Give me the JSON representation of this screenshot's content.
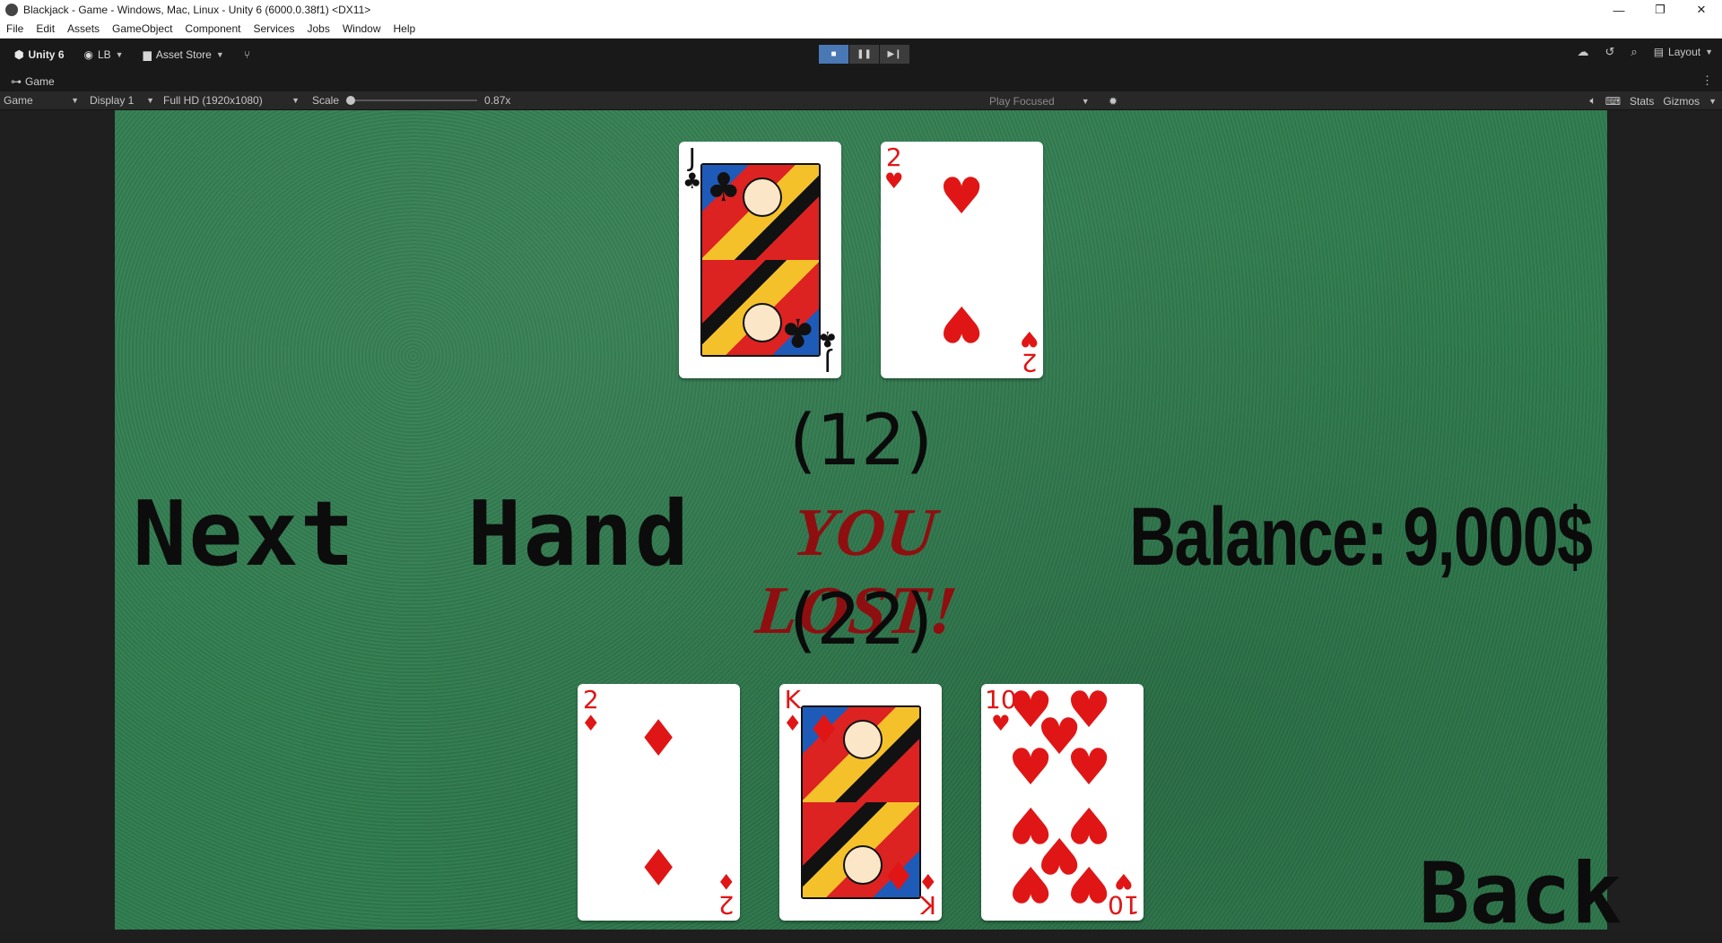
{
  "window": {
    "title": "Blackjack - Game - Windows, Mac, Linux - Unity 6 (6000.0.38f1) <DX11>",
    "minimize": "—",
    "maximize": "❐",
    "close": "✕"
  },
  "menu": [
    "File",
    "Edit",
    "Assets",
    "GameObject",
    "Component",
    "Services",
    "Jobs",
    "Window",
    "Help"
  ],
  "toolbar": {
    "unity_label": "Unity 6",
    "account_label": "LB",
    "asset_store_label": "Asset Store",
    "layout_label": "Layout"
  },
  "tab": {
    "label": "Game"
  },
  "gamebar": {
    "view_select": "Game",
    "display_select": "Display 1",
    "resolution_select": "Full HD (1920x1080)",
    "scale_label": "Scale",
    "scale_value": "0.87x",
    "scale_fraction": 0,
    "play_focused": "Play Focused",
    "stats_label": "Stats",
    "gizmos_label": "Gizmos"
  },
  "game": {
    "dealer_total": "(12)",
    "player_total": "(22)",
    "result_text": "YOU LOST!",
    "next_hand_label": "Next  Hand",
    "balance_text": "Balance: 9,000$",
    "back_label": "Back",
    "dealer_cards": [
      {
        "rank": "J",
        "suit": "♣",
        "color": "#111111"
      },
      {
        "rank": "2",
        "suit": "♥",
        "color": "#e01616"
      }
    ],
    "player_cards": [
      {
        "rank": "2",
        "suit": "♦",
        "color": "#e01616"
      },
      {
        "rank": "K",
        "suit": "♦",
        "color": "#e01616"
      },
      {
        "rank": "10",
        "suit": "♥",
        "color": "#e01616"
      }
    ]
  },
  "colors": {
    "felt": "#2f7b4e",
    "result_red": "#8f0e10",
    "play_active": "#4a78b5"
  }
}
